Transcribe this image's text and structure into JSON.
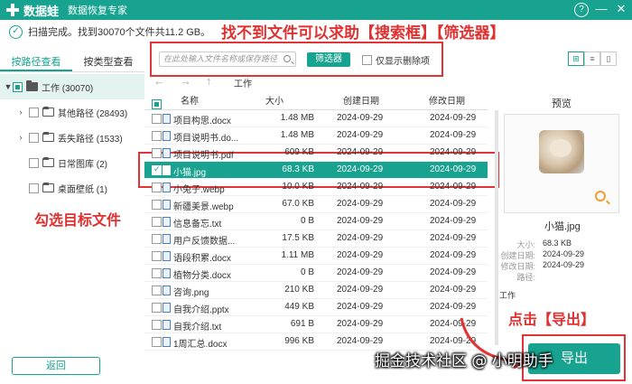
{
  "titlebar": {
    "app_name": "数据蛙",
    "subtitle": "数据恢复专家",
    "help": "?",
    "minimize": "—",
    "close": "✕"
  },
  "status": {
    "text": "扫描完成。找到30070个文件共11.2 GB。"
  },
  "annotations": {
    "top": "找不到文件可以求助【搜索框】【筛选器】",
    "left": "勾选目标文件",
    "right": "点击【导出】"
  },
  "sidebar": {
    "tabs": [
      {
        "label": "按路径查看",
        "active": true
      },
      {
        "label": "按类型查看",
        "active": false
      }
    ],
    "tree": [
      {
        "label": "工作 (30070)",
        "level": 0,
        "expand": "▼"
      },
      {
        "label": "其他路径 (28493)",
        "level": 1,
        "expand": "›"
      },
      {
        "label": "丢失路径 (1533)",
        "level": 1,
        "expand": "›"
      },
      {
        "label": "日常图库 (2)",
        "level": 1,
        "expand": ""
      },
      {
        "label": "桌面壁纸 (1)",
        "level": 1,
        "expand": ""
      }
    ],
    "back_label": "返回"
  },
  "toolbar": {
    "search_placeholder": "在此处输入文件名称或保存路径",
    "filter_label": "筛选器",
    "deleted_only_label": "仅显示删除项",
    "views": [
      "⊞",
      "≡",
      "▯"
    ]
  },
  "breadcrumb": {
    "back": "←",
    "forward": "→",
    "up": "↑",
    "path": "工作"
  },
  "table": {
    "headers": {
      "name": "名称",
      "size": "大小",
      "created": "创建日期",
      "modified": "修改日期"
    },
    "rows": [
      {
        "name": "项目构思.docx",
        "size": "1.48 MB",
        "created": "2024-09-29",
        "modified": "2024-09-29",
        "selected": false
      },
      {
        "name": "项目说明书.do...",
        "size": "1.48 MB",
        "created": "2024-09-29",
        "modified": "2024-09-29",
        "selected": false
      },
      {
        "name": "项目说明书.pdf",
        "size": "609 KB",
        "created": "2024-09-29",
        "modified": "2024-09-29",
        "selected": false
      },
      {
        "name": "小猫.jpg",
        "size": "68.3 KB",
        "created": "2024-09-29",
        "modified": "2024-09-29",
        "selected": true
      },
      {
        "name": "小兔子.webp",
        "size": "10.0 KB",
        "created": "2024-09-29",
        "modified": "2024-09-29",
        "selected": false
      },
      {
        "name": "新疆美景.webp",
        "size": "67.0 KB",
        "created": "2024-09-29",
        "modified": "2024-09-29",
        "selected": false
      },
      {
        "name": "信息备忘.txt",
        "size": "0 B",
        "created": "2024-09-29",
        "modified": "2024-09-29",
        "selected": false
      },
      {
        "name": "用户反馈数据...",
        "size": "17.5 KB",
        "created": "2024-09-29",
        "modified": "2024-09-29",
        "selected": false
      },
      {
        "name": "语段积累.docx",
        "size": "1.11 MB",
        "created": "2024-09-29",
        "modified": "2024-09-29",
        "selected": false
      },
      {
        "name": "植物分类.docx",
        "size": "0 B",
        "created": "2024-09-29",
        "modified": "2024-09-29",
        "selected": false
      },
      {
        "name": "咨询.png",
        "size": "210 KB",
        "created": "2024-09-29",
        "modified": "2024-09-29",
        "selected": false
      },
      {
        "name": "自我介绍.pptx",
        "size": "449 KB",
        "created": "2024-09-29",
        "modified": "2024-09-29",
        "selected": false
      },
      {
        "name": "自我介绍.txt",
        "size": "691 B",
        "created": "2024-09-29",
        "modified": "2024-09-29",
        "selected": false
      },
      {
        "name": "1周汇总.docx",
        "size": "996 KB",
        "created": "2024-09-29",
        "modified": "2024-09-29",
        "selected": false
      }
    ]
  },
  "preview": {
    "title": "预览",
    "file_name": "小猫.jpg",
    "info": [
      {
        "key": "大小:",
        "value": "68.3 KB"
      },
      {
        "key": "创建日期:",
        "value": "2024-09-29"
      },
      {
        "key": "修改日期:",
        "value": "2024-09-29"
      },
      {
        "key": "路径:",
        "value": ""
      }
    ],
    "path_value": "工作"
  },
  "export_label": "导出",
  "watermark": "掘金技术社区 @ 小明助手",
  "colors": {
    "accent": "#17a38f",
    "annotation": "#e23434"
  }
}
